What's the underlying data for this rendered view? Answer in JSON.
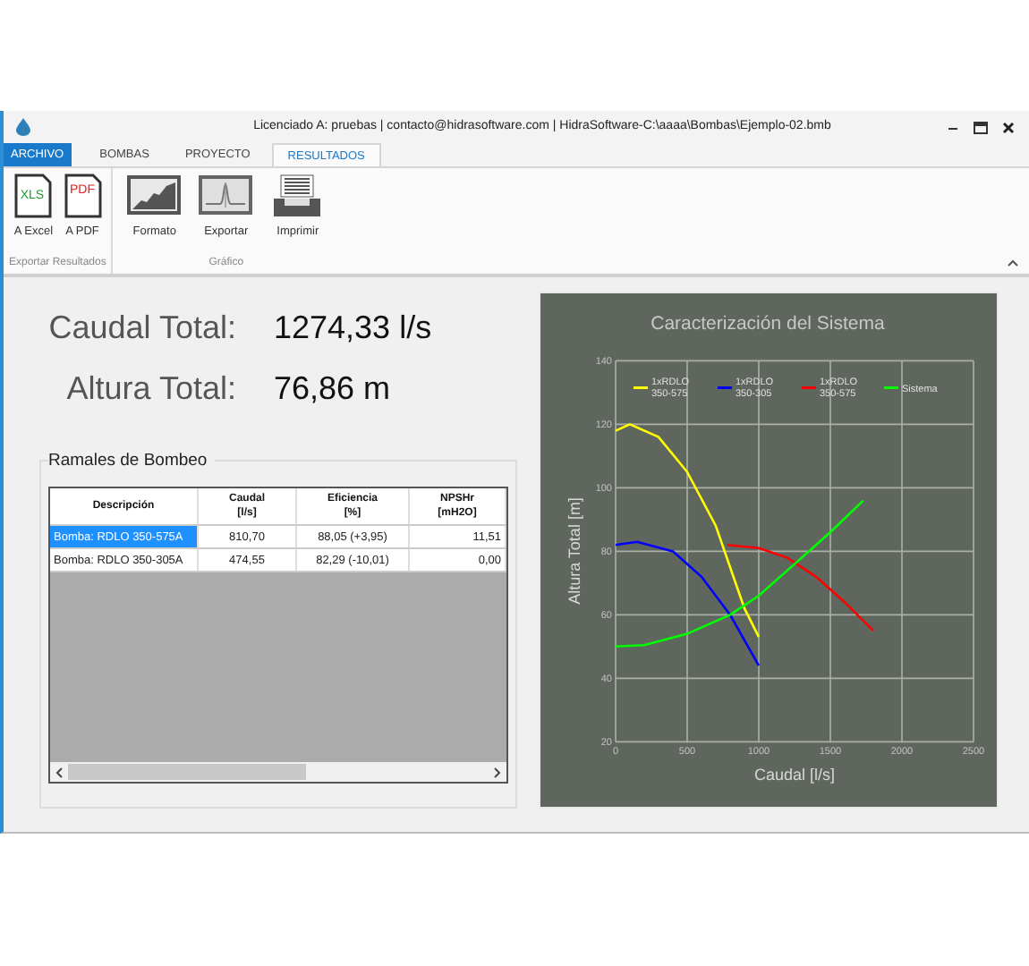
{
  "window": {
    "title": "Licenciado A: pruebas | contacto@hidrasoftware.com | HidraSoftware-C:\\aaaa\\Bombas\\Ejemplo-02.bmb"
  },
  "tabs": [
    {
      "label": "ARCHIVO",
      "kind": "file",
      "selected": false
    },
    {
      "label": "BOMBAS",
      "kind": "tab",
      "selected": false
    },
    {
      "label": "PROYECTO",
      "kind": "tab",
      "selected": false
    },
    {
      "label": "RESULTADOS",
      "kind": "tab",
      "selected": true
    }
  ],
  "ribbon_groups": [
    {
      "label": "Exportar Resultados",
      "buttons": [
        {
          "label": "A Excel",
          "kind": "xls",
          "icon_text": "XLS"
        },
        {
          "label": "A PDF",
          "kind": "pdf",
          "icon_text": "PDF"
        }
      ]
    },
    {
      "label": "Gráfico",
      "buttons": [
        {
          "label": "Formato",
          "kind": "format"
        },
        {
          "label": "Exportar",
          "kind": "export"
        },
        {
          "label": "Imprimir",
          "kind": "print"
        }
      ]
    }
  ],
  "summary": [
    {
      "label": "Caudal Total:",
      "value": "1274,33 l/s"
    },
    {
      "label": "Altura Total:",
      "value": "76,86 m"
    }
  ],
  "pump_branches": {
    "title": "Ramales de Bombeo",
    "columns": [
      "Descripción",
      "Caudal [l/s]",
      "Eficiencia [%]",
      "NPSHr [mH2O]"
    ],
    "rows": [
      {
        "selected": true,
        "cells": [
          "Bomba: RDLO 350-575A",
          "810,70",
          "88,05 (+3,95)",
          "11,51"
        ]
      },
      {
        "selected": false,
        "cells": [
          "Bomba: RDLO 350-305A",
          "474,55",
          "82,29 (-10,01)",
          "0,00"
        ]
      }
    ]
  },
  "chart": {
    "chart_data": {
      "type": "line",
      "title": "Caracterización del Sistema",
      "xlabel": "Caudal [l/s]",
      "ylabel": "Altura Total [m]",
      "xlim": [
        0,
        2500
      ],
      "ylim": [
        20,
        140
      ],
      "xticks": [
        0,
        500,
        1000,
        1500,
        2000,
        {
          "value": 2500,
          "label": "2500"
        }
      ],
      "yticks": [
        20,
        40,
        60,
        80,
        100,
        120,
        140
      ],
      "grid": true,
      "legend": true,
      "series": [
        {
          "name": "1xRDLO 350-575",
          "color": "#ffff00",
          "x": [
            0,
            100,
            300,
            500,
            700,
            800,
            900,
            1000
          ],
          "values": [
            118,
            120,
            116,
            105,
            88,
            75,
            62,
            53
          ]
        },
        {
          "name": "1xRDLO 350-305",
          "color": "#0000ff",
          "x": [
            0,
            150,
            400,
            600,
            800,
            1000
          ],
          "values": [
            82,
            83,
            80,
            72,
            60,
            44
          ]
        },
        {
          "name": "1xRDLO 350-575",
          "color": "#ff0000",
          "x": [
            780,
            1000,
            1200,
            1400,
            1600,
            1800
          ],
          "values": [
            82,
            81,
            78,
            72,
            64,
            55
          ]
        },
        {
          "name": "Sistema",
          "color": "#00ff00",
          "x": [
            0,
            200,
            500,
            800,
            1000,
            1250,
            1500,
            1730
          ],
          "values": [
            50,
            50.5,
            54,
            60,
            66,
            76,
            86,
            96
          ]
        }
      ]
    }
  }
}
